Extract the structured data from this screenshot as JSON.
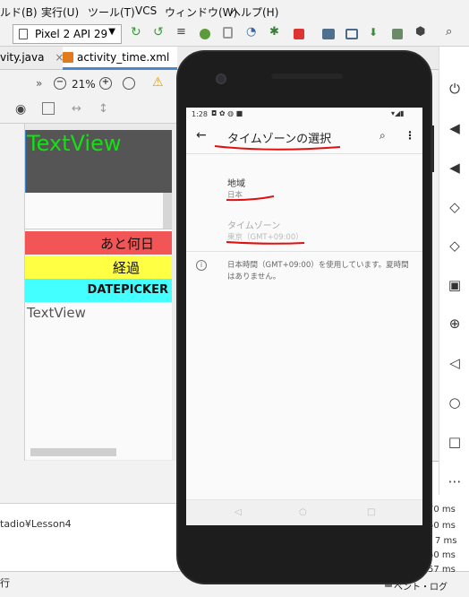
{
  "menu": [
    "ルド(B)",
    "実行(U)",
    "ツール(T)",
    "VCS",
    "ウィンドウ(W)",
    "ヘルプ(H)"
  ],
  "toolbar": {
    "device": "Pixel 2 API 29"
  },
  "tabs": [
    "vity.java",
    "activity_time.xml"
  ],
  "design_toolbar": {
    "zoom": "21%",
    "overflow": "»"
  },
  "preview": {
    "textview_top": "TextView",
    "bar_red": "あと何日",
    "bar_yellow": "経過",
    "bar_cyan": "DATEPICKER",
    "textview_bottom": "TextView",
    "colors": {
      "red": "#f25555",
      "yellow": "#ffff44",
      "cyan": "#44ffff",
      "green_text": "#14e014"
    }
  },
  "bottom": {
    "path": "tadio¥Lesson4",
    "status": "行",
    "event_log": "ベント・ログ",
    "timings": [
      "70 ms",
      "50 ms",
      "7 ms",
      "50 ms",
      "57 ms"
    ]
  },
  "phone": {
    "statusbar_time": "1:28",
    "title": "タイムゾーンの選択",
    "region_label": "地域",
    "region_value": "日本",
    "tz_label": "タイムゾーン",
    "tz_value": "東京（GMT+09:00）",
    "info": "日本時間（GMT+09:00）を使用しています。夏時間はありません。"
  }
}
